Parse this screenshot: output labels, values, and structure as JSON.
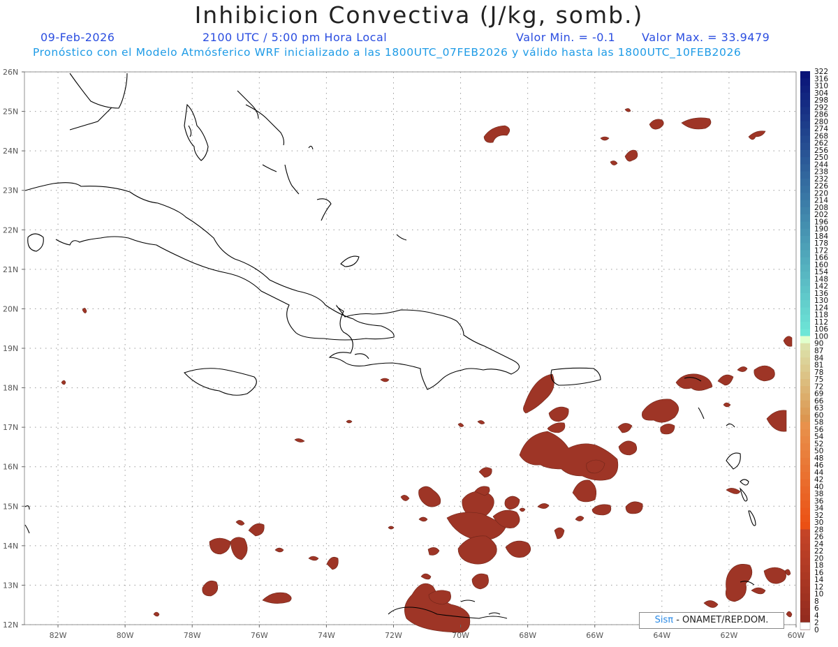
{
  "header": {
    "title": "Inhibicion Convectiva (J/kg, somb.)",
    "date": "09-Feb-2026",
    "time": "2100 UTC / 5:00 pm Hora Local",
    "valor_min": "Valor Min. = -0.1",
    "valor_max": "Valor Max. = 33.9479",
    "forecast_info": "Pronóstico con el Modelo Atmósferico WRF inicializado a las 1800UTC_07FEB2026 y válido hasta las  1800UTC_10FEB2026"
  },
  "map": {
    "lon_range": [
      -83,
      -60
    ],
    "lat_range": [
      12,
      26
    ],
    "lon_ticks": [
      "82W",
      "80W",
      "78W",
      "76W",
      "74W",
      "72W",
      "70W",
      "68W",
      "66W",
      "64W",
      "62W",
      "60W"
    ],
    "lat_ticks": [
      "26N",
      "25N",
      "24N",
      "23N",
      "22N",
      "21N",
      "20N",
      "19N",
      "18N",
      "17N",
      "16N",
      "15N",
      "14N",
      "13N",
      "12N"
    ],
    "shading_color": "#9e3526",
    "coast_color": "#000000",
    "grid_color": "#9a9a9a"
  },
  "colorbar": {
    "labels": [
      "322",
      "316",
      "310",
      "304",
      "298",
      "292",
      "286",
      "280",
      "274",
      "268",
      "262",
      "256",
      "250",
      "244",
      "238",
      "232",
      "226",
      "220",
      "214",
      "208",
      "202",
      "196",
      "190",
      "184",
      "178",
      "172",
      "166",
      "160",
      "154",
      "148",
      "142",
      "136",
      "130",
      "124",
      "118",
      "112",
      "106",
      "100",
      "90",
      "87",
      "84",
      "81",
      "78",
      "75",
      "72",
      "69",
      "66",
      "63",
      "60",
      "58",
      "56",
      "54",
      "52",
      "50",
      "48",
      "46",
      "44",
      "42",
      "40",
      "38",
      "36",
      "34",
      "32",
      "30",
      "28",
      "26",
      "24",
      "22",
      "20",
      "18",
      "16",
      "14",
      "12",
      "10",
      "8",
      "6",
      "4",
      "2",
      "0"
    ]
  },
  "credit": {
    "sis": "Sisπ",
    "text": " - ONAMET/REP.DOM."
  }
}
